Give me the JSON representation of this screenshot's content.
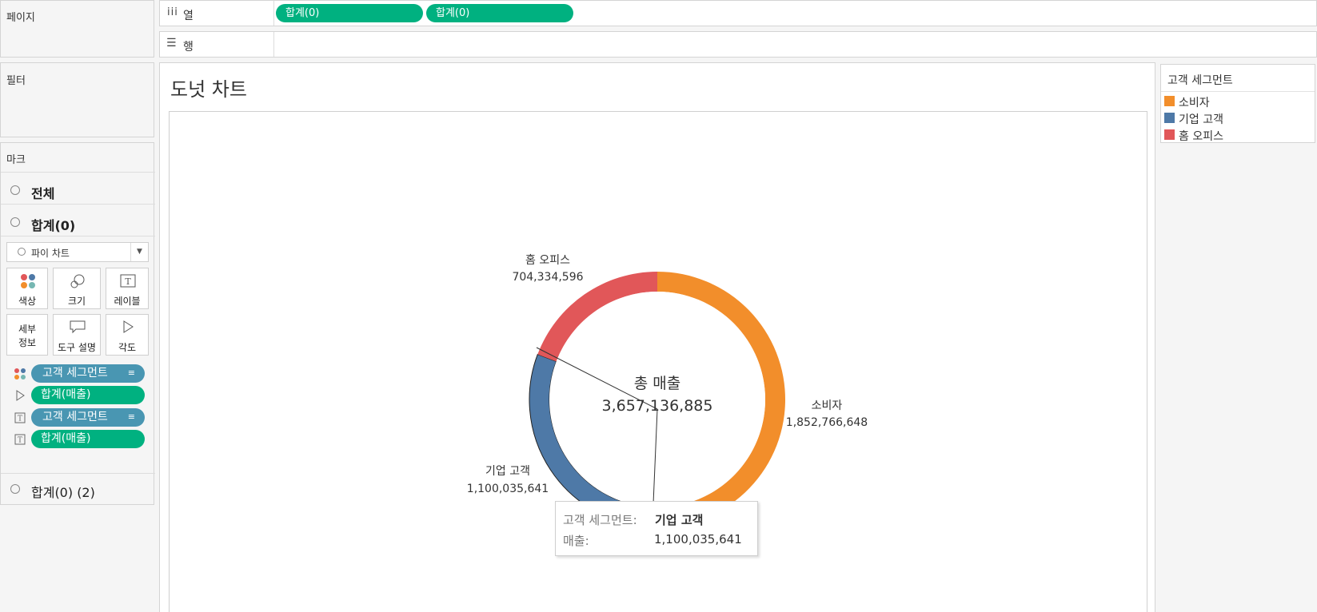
{
  "left_panel": {
    "pages_label": "페이지",
    "filters_label": "필터",
    "marks_label": "마크",
    "mark_rows": [
      {
        "label": "전체",
        "bold": true
      },
      {
        "label": "합계(0)",
        "bold": true
      },
      {
        "label": "합계(0) (2)",
        "bold": false
      }
    ],
    "mark_type": "파이 차트",
    "buttons": {
      "color": "색상",
      "size": "크기",
      "label": "레이블",
      "detail_line1": "세부",
      "detail_line2": "정보",
      "tooltip": "도구 설명",
      "angle": "각도"
    },
    "mark_pills": [
      {
        "text": "고객 세그먼트",
        "kind": "blue",
        "icon": "color-dots-icon"
      },
      {
        "text": "합계(매출)",
        "kind": "green",
        "icon": "angle-icon"
      },
      {
        "text": "고객 세그먼트",
        "kind": "blue",
        "icon": "text-icon"
      },
      {
        "text": "합계(매출)",
        "kind": "green",
        "icon": "text-icon"
      }
    ]
  },
  "shelves": {
    "columns_label": "열",
    "rows_label": "행",
    "column_pills": [
      "합계(0)",
      "합계(0)"
    ]
  },
  "view": {
    "title": "도넛 차트"
  },
  "legend": {
    "title": "고객 세그먼트",
    "items": [
      {
        "label": "소비자",
        "color": "#f28e2b"
      },
      {
        "label": "기업 고객",
        "color": "#4e79a7"
      },
      {
        "label": "홈 오피스",
        "color": "#e15759"
      }
    ]
  },
  "chart_data": {
    "type": "pie",
    "center_label": "총 매출",
    "center_value": "3,657,136,885",
    "total": 3657136885,
    "categories": [
      "소비자",
      "기업 고객",
      "홈 오피스"
    ],
    "values": [
      1852766648,
      1100035641,
      704334596
    ],
    "value_labels": [
      "1,852,766,648",
      "1,100,035,641",
      "704,334,596"
    ],
    "colors": [
      "#f28e2b",
      "#4e79a7",
      "#e15759"
    ]
  },
  "tooltip": {
    "segment_key": "고객 세그먼트:",
    "segment_value": "기업 고객",
    "sales_key": "매출:",
    "sales_value": "1,100,035,641"
  }
}
